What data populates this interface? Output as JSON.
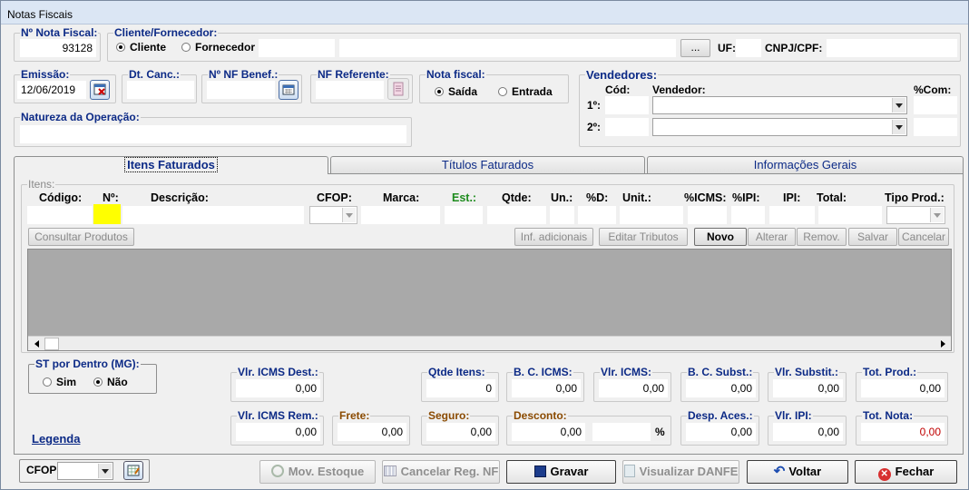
{
  "window": {
    "title": "Notas Fiscais"
  },
  "header": {
    "nf_number": {
      "label": "Nº Nota Fiscal:",
      "value": "93128"
    },
    "client": {
      "label": "Cliente/Fornecedor:",
      "option_cliente": "Cliente",
      "option_fornecedor": "Fornecedor",
      "name": "",
      "browse_label": "...",
      "uf_label": "UF:",
      "uf": "",
      "cnpj_label": "CNPJ/CPF:",
      "cnpj": ""
    },
    "emissao": {
      "label": "Emissão:",
      "value": "12/06/2019"
    },
    "dt_canc": {
      "label": "Dt. Canc.:",
      "value": ""
    },
    "nf_benef": {
      "label": "Nº NF Benef.:",
      "value": ""
    },
    "nf_referente": {
      "label": "NF Referente:",
      "value": ""
    },
    "nota_fiscal": {
      "label": "Nota fiscal:",
      "option_saida": "Saída",
      "option_entrada": "Entrada"
    },
    "natureza": {
      "label": "Natureza da Operação:",
      "value": ""
    },
    "vendedores": {
      "label": "Vendedores:",
      "cod_label": "Cód:",
      "vendedor_label": "Vendedor:",
      "com_label": "%Com:",
      "row1": "1º:",
      "row2": "2º:"
    }
  },
  "tabs": [
    {
      "label": "Itens Faturados"
    },
    {
      "label": "Títulos Faturados"
    },
    {
      "label": "Informações Gerais"
    }
  ],
  "items": {
    "group_label": "Itens:",
    "columns": {
      "codigo": "Código:",
      "no": "Nº:",
      "descricao": "Descrição:",
      "cfop": "CFOP:",
      "marca": "Marca:",
      "est": "Est.:",
      "qtde": "Qtde:",
      "un": "Un.:",
      "pd": "%D:",
      "unit": "Unit.:",
      "icms": "%ICMS:",
      "ipi_pct": "%IPI:",
      "ipi": "IPI:",
      "total": "Total:",
      "tipo": "Tipo Prod.:"
    },
    "buttons": {
      "consultar": "Consultar Produtos",
      "info": "Inf. adicionais",
      "editar": "Editar Tributos",
      "novo": "Novo",
      "alterar": "Alterar",
      "remov": "Remov.",
      "salvar": "Salvar",
      "cancelar": "Cancelar"
    }
  },
  "st": {
    "label": "ST por Dentro (MG):",
    "sim": "Sim",
    "nao": "Não"
  },
  "totals": {
    "vlr_icms_dest": {
      "label": "Vlr. ICMS Dest.:",
      "value": "0,00"
    },
    "qtde_itens": {
      "label": "Qtde Itens:",
      "value": "0"
    },
    "bc_icms": {
      "label": "B. C. ICMS:",
      "value": "0,00"
    },
    "vlr_icms": {
      "label": "Vlr. ICMS:",
      "value": "0,00"
    },
    "bc_subst": {
      "label": "B. C. Subst.:",
      "value": "0,00"
    },
    "vlr_substit": {
      "label": "Vlr. Substit.:",
      "value": "0,00"
    },
    "tot_prod": {
      "label": "Tot. Prod.:",
      "value": "0,00"
    },
    "vlr_icms_rem": {
      "label": "Vlr. ICMS Rem.:",
      "value": "0,00"
    },
    "frete": {
      "label": "Frete:",
      "value": "0,00"
    },
    "seguro": {
      "label": "Seguro:",
      "value": "0,00"
    },
    "desconto": {
      "label": "Desconto:",
      "value": "0,00",
      "pct": "",
      "pct_symbol": "%"
    },
    "desp_aces": {
      "label": "Desp. Aces.:",
      "value": "0,00"
    },
    "vlr_ipi": {
      "label": "Vlr. IPI:",
      "value": "0,00"
    },
    "tot_nota": {
      "label": "Tot. Nota:",
      "value": "0,00"
    }
  },
  "legenda": "Legenda",
  "footer": {
    "cfop_label": "CFOP:",
    "mov_estoque": "Mov. Estoque",
    "cancelar_reg": "Cancelar Reg. NF",
    "gravar": "Gravar",
    "visualizar": "Visualizar DANFE",
    "voltar": "Voltar",
    "fechar": "Fechar"
  },
  "colors": {
    "group_title": "#0c2a86",
    "est_label": "#1e8c1e",
    "brown_label": "#8a4a00",
    "tot_nota_value": "#c00000",
    "highlight": "#ffff00",
    "grid_bg": "#a9a9a9"
  }
}
